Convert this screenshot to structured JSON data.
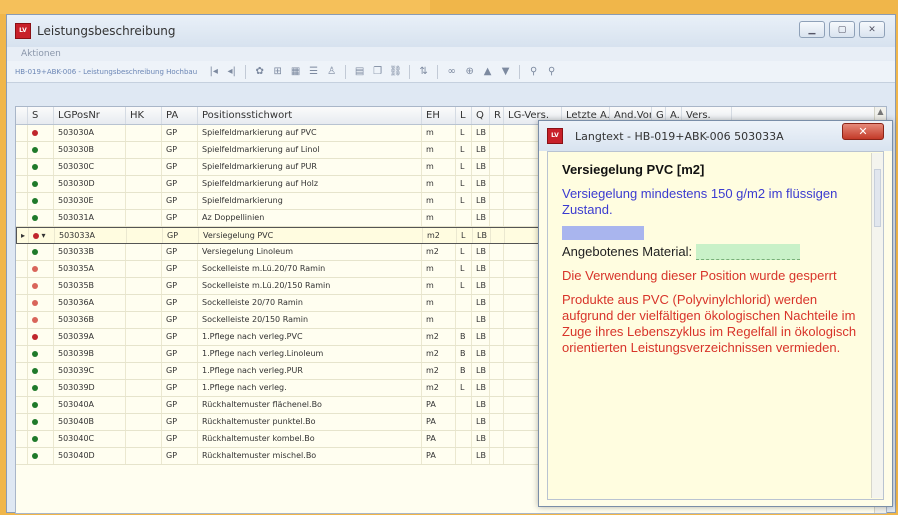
{
  "window": {
    "title": "Leistungsbeschreibung"
  },
  "menu": {
    "aktionen": "Aktionen"
  },
  "breadcrumb": "HB-019+ABK-006 - Leistungsbeschreibung Hochbau",
  "columns": [
    "S",
    "LGPosNr",
    "HK",
    "PA",
    "Positionsstichwort",
    "EH",
    "L",
    "Q",
    "R",
    "LG-Vers.",
    "Letzte A...",
    "And.Von",
    "G",
    "A...",
    "Vers."
  ],
  "rows": [
    {
      "dot": "#c0262c",
      "nr": "503030A",
      "pa": "GP",
      "pos": "Spielfeldmarkierung auf PVC",
      "eh": "m",
      "l": "L",
      "q": "LB"
    },
    {
      "dot": "#1f7a2a",
      "nr": "503030B",
      "pa": "GP",
      "pos": "Spielfeldmarkierung auf Linol",
      "eh": "m",
      "l": "L",
      "q": "LB"
    },
    {
      "dot": "#1f7a2a",
      "nr": "503030C",
      "pa": "GP",
      "pos": "Spielfeldmarkierung auf PUR",
      "eh": "m",
      "l": "L",
      "q": "LB"
    },
    {
      "dot": "#1f7a2a",
      "nr": "503030D",
      "pa": "GP",
      "pos": "Spielfeldmarkierung auf Holz",
      "eh": "m",
      "l": "L",
      "q": "LB"
    },
    {
      "dot": "#1f7a2a",
      "nr": "503030E",
      "pa": "GP",
      "pos": "Spielfeldmarkierung",
      "eh": "m",
      "l": "L",
      "q": "LB"
    },
    {
      "dot": "#1f7a2a",
      "nr": "503031A",
      "pa": "GP",
      "pos": "Az Doppellinien",
      "eh": "m",
      "l": "",
      "q": "LB"
    },
    {
      "dot": "#c0262c",
      "nr": "503033A",
      "pa": "GP",
      "pos": "Versiegelung PVC",
      "eh": "m2",
      "l": "L",
      "q": "LB",
      "selected": true
    },
    {
      "dot": "#1f7a2a",
      "nr": "503033B",
      "pa": "GP",
      "pos": "Versiegelung Linoleum",
      "eh": "m2",
      "l": "L",
      "q": "LB"
    },
    {
      "dot": "#d9655a",
      "nr": "503035A",
      "pa": "GP",
      "pos": "Sockelleiste m.Lü.20/70 Ramin",
      "eh": "m",
      "l": "L",
      "q": "LB"
    },
    {
      "dot": "#d9655a",
      "nr": "503035B",
      "pa": "GP",
      "pos": "Sockelleiste m.Lü.20/150 Ramin",
      "eh": "m",
      "l": "L",
      "q": "LB"
    },
    {
      "dot": "#d9655a",
      "nr": "503036A",
      "pa": "GP",
      "pos": "Sockelleiste 20/70 Ramin",
      "eh": "m",
      "l": "",
      "q": "LB"
    },
    {
      "dot": "#d9655a",
      "nr": "503036B",
      "pa": "GP",
      "pos": "Sockelleiste 20/150 Ramin",
      "eh": "m",
      "l": "",
      "q": "LB"
    },
    {
      "dot": "#c0262c",
      "nr": "503039A",
      "pa": "GP",
      "pos": "1.Pflege nach verleg.PVC",
      "eh": "m2",
      "l": "B",
      "q": "LB"
    },
    {
      "dot": "#1f7a2a",
      "nr": "503039B",
      "pa": "GP",
      "pos": "1.Pflege nach verleg.Linoleum",
      "eh": "m2",
      "l": "B",
      "q": "LB"
    },
    {
      "dot": "#1f7a2a",
      "nr": "503039C",
      "pa": "GP",
      "pos": "1.Pflege nach verleg.PUR",
      "eh": "m2",
      "l": "B",
      "q": "LB"
    },
    {
      "dot": "#1f7a2a",
      "nr": "503039D",
      "pa": "GP",
      "pos": "1.Pflege nach verleg.",
      "eh": "m2",
      "l": "L",
      "q": "LB"
    },
    {
      "dot": "#1f7a2a",
      "nr": "503040A",
      "pa": "GP",
      "pos": "Rückhaltemuster flächenel.Bo",
      "eh": "PA",
      "l": "",
      "q": "LB"
    },
    {
      "dot": "#1f7a2a",
      "nr": "503040B",
      "pa": "GP",
      "pos": "Rückhaltemuster punktel.Bo",
      "eh": "PA",
      "l": "",
      "q": "LB"
    },
    {
      "dot": "#1f7a2a",
      "nr": "503040C",
      "pa": "GP",
      "pos": "Rückhaltemuster kombel.Bo",
      "eh": "PA",
      "l": "",
      "q": "LB"
    },
    {
      "dot": "#1f7a2a",
      "nr": "503040D",
      "pa": "GP",
      "pos": "Rückhaltemuster mischel.Bo",
      "eh": "PA",
      "l": "",
      "q": "LB"
    }
  ],
  "popup": {
    "title": "Langtext - HB-019+ABK-006  503033A",
    "close": "✕",
    "heading": "Versiegelung PVC [m2]",
    "desc": "Versiegelung mindestens 150 g/m2 im flüssigen Zustand.",
    "material_label": "Angebotenes Material:",
    "locked": "Die Verwendung dieser Position wurde gesperrt",
    "note": "Produkte aus PVC (Polyvinylchlorid) werden aufgrund der vielfältigen ökologischen Nachteile im Zuge ihres Lebenszyklus im Regelfall in ökologisch orientierten Leistungsverzeichnissen vermieden."
  }
}
